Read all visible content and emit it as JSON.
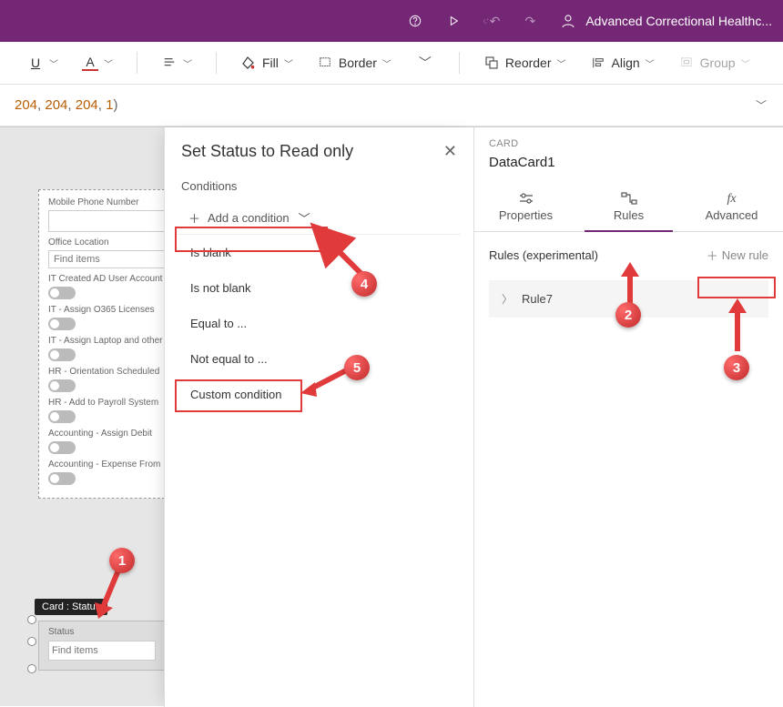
{
  "topbar": {
    "org": "Advanced Correctional Healthc..."
  },
  "ribbon": {
    "fill": "Fill",
    "border": "Border",
    "reorder": "Reorder",
    "align": "Align",
    "group": "Group"
  },
  "formula": {
    "text_prefix": "204",
    "text_mid": "204",
    "text_mid2": "204",
    "text_suffix": "1"
  },
  "form": {
    "f1": "Mobile Phone Number",
    "f2": "Office Location",
    "f2_ph": "Find items",
    "f3": "IT Created AD User Account",
    "f4": "IT - Assign O365 Licenses",
    "f5": "IT - Assign Laptop and other",
    "f6": "HR - Orientation Scheduled",
    "f7": "HR - Add to Payroll System",
    "f8": "Accounting - Assign Debit",
    "f9": "Accounting - Expense From",
    "status_lbl": "Status",
    "status_ph": "Find items",
    "tooltip": "Card : Status"
  },
  "flyout": {
    "title": "Set Status to Read only",
    "conditions": "Conditions",
    "add": "Add a condition",
    "opts": {
      "blank": "Is blank",
      "notblank": "Is not blank",
      "eq": "Equal to ...",
      "neq": "Not equal to ...",
      "custom": "Custom condition"
    }
  },
  "rpane": {
    "hdr": "CARD",
    "name": "DataCard1",
    "tab_props": "Properties",
    "tab_rules": "Rules",
    "tab_adv": "Advanced",
    "rules_label": "Rules (experimental)",
    "newrule": "New rule",
    "rule1": "Rule7"
  },
  "balls": {
    "n1": "1",
    "n2": "2",
    "n3": "3",
    "n4": "4",
    "n5": "5"
  }
}
